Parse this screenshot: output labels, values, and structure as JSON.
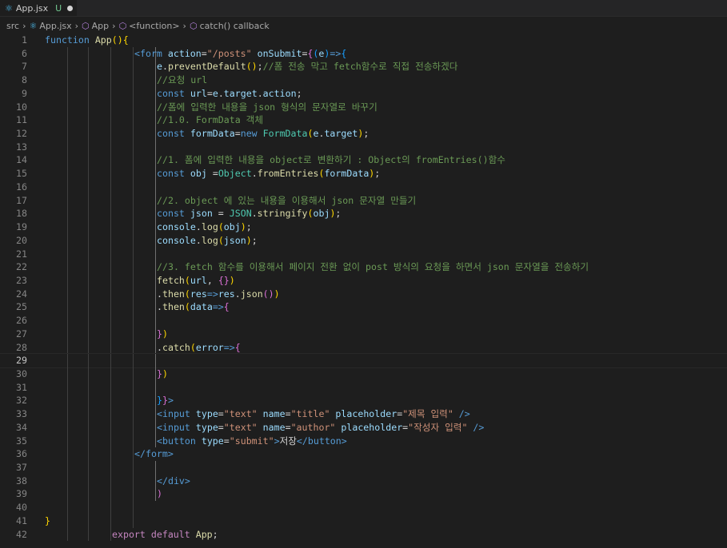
{
  "tab": {
    "filename": "App.jsx",
    "status": "U"
  },
  "breadcrumb": {
    "items": [
      "src",
      "App.jsx",
      "App",
      "<function>",
      "catch() callback"
    ]
  },
  "editor": {
    "active_line": "29",
    "lines": [
      {
        "n": "1",
        "tokens": [
          [
            "k",
            "function"
          ],
          [
            "w",
            " "
          ],
          [
            "f",
            "App"
          ],
          [
            "b1",
            "()"
          ],
          [
            "b1",
            "{"
          ]
        ]
      },
      {
        "n": "6",
        "tokens": [
          [
            "tag",
            "<form "
          ],
          [
            "v",
            "action"
          ],
          [
            "w",
            "="
          ],
          [
            "s",
            "\"/posts\""
          ],
          [
            "w",
            " "
          ],
          [
            "v",
            "onSubmit"
          ],
          [
            "w",
            "="
          ],
          [
            "b2",
            "{"
          ],
          [
            "b3",
            "("
          ],
          [
            "v",
            "e"
          ],
          [
            "b3",
            ")"
          ],
          [
            "k",
            "=>"
          ],
          [
            "b3",
            "{"
          ]
        ]
      },
      {
        "n": "7",
        "tokens": [
          [
            "v",
            "e"
          ],
          [
            "w",
            "."
          ],
          [
            "f",
            "preventDefault"
          ],
          [
            "b1",
            "()"
          ],
          [
            "w",
            ";"
          ],
          [
            "cm",
            "//폼 전송 막고 fetch함수로 직접 전송하겠다"
          ]
        ]
      },
      {
        "n": "8",
        "tokens": [
          [
            "cm",
            "//요청 url"
          ]
        ]
      },
      {
        "n": "9",
        "tokens": [
          [
            "k",
            "const "
          ],
          [
            "v",
            "url"
          ],
          [
            "w",
            "="
          ],
          [
            "v",
            "e"
          ],
          [
            "w",
            "."
          ],
          [
            "v",
            "target"
          ],
          [
            "w",
            "."
          ],
          [
            "v",
            "action"
          ],
          [
            "w",
            ";"
          ]
        ]
      },
      {
        "n": "10",
        "tokens": [
          [
            "cm",
            "//폼에 입력한 내용을 json 형식의 문자열로 바꾸기"
          ]
        ]
      },
      {
        "n": "11",
        "tokens": [
          [
            "cm",
            "//1.0. FormData 객체"
          ]
        ]
      },
      {
        "n": "12",
        "tokens": [
          [
            "k",
            "const "
          ],
          [
            "v",
            "formData"
          ],
          [
            "w",
            "="
          ],
          [
            "k",
            "new "
          ],
          [
            "t",
            "FormData"
          ],
          [
            "b1",
            "("
          ],
          [
            "v",
            "e"
          ],
          [
            "w",
            "."
          ],
          [
            "v",
            "target"
          ],
          [
            "b1",
            ")"
          ],
          [
            "w",
            ";"
          ]
        ]
      },
      {
        "n": "13",
        "tokens": []
      },
      {
        "n": "14",
        "tokens": [
          [
            "cm",
            "//1. 폼에 입력한 내용을 object로 변환하기 : Object의 fromEntries()함수"
          ]
        ]
      },
      {
        "n": "15",
        "tokens": [
          [
            "k",
            "const "
          ],
          [
            "v",
            "obj"
          ],
          [
            "w",
            " ="
          ],
          [
            "t",
            "Object"
          ],
          [
            "w",
            "."
          ],
          [
            "f",
            "fromEntries"
          ],
          [
            "b1",
            "("
          ],
          [
            "v",
            "formData"
          ],
          [
            "b1",
            ")"
          ],
          [
            "w",
            ";"
          ]
        ]
      },
      {
        "n": "16",
        "tokens": []
      },
      {
        "n": "17",
        "tokens": [
          [
            "cm",
            "//2. object 에 있는 내용을 이용해서 json 문자열 만들기"
          ]
        ]
      },
      {
        "n": "18",
        "tokens": [
          [
            "k",
            "const "
          ],
          [
            "v",
            "json"
          ],
          [
            "w",
            " = "
          ],
          [
            "t",
            "JSON"
          ],
          [
            "w",
            "."
          ],
          [
            "f",
            "stringify"
          ],
          [
            "b1",
            "("
          ],
          [
            "v",
            "obj"
          ],
          [
            "b1",
            ")"
          ],
          [
            "w",
            ";"
          ]
        ]
      },
      {
        "n": "19",
        "tokens": [
          [
            "v",
            "console"
          ],
          [
            "w",
            "."
          ],
          [
            "f",
            "log"
          ],
          [
            "b1",
            "("
          ],
          [
            "v",
            "obj"
          ],
          [
            "b1",
            ")"
          ],
          [
            "w",
            ";"
          ]
        ]
      },
      {
        "n": "20",
        "tokens": [
          [
            "v",
            "console"
          ],
          [
            "w",
            "."
          ],
          [
            "f",
            "log"
          ],
          [
            "b1",
            "("
          ],
          [
            "v",
            "json"
          ],
          [
            "b1",
            ")"
          ],
          [
            "w",
            ";"
          ]
        ]
      },
      {
        "n": "21",
        "tokens": []
      },
      {
        "n": "22",
        "tokens": [
          [
            "cm",
            "//3. fetch 함수를 이용해서 페이지 전환 없이 post 방식의 요청을 하면서 json 문자열을 전송하기"
          ]
        ]
      },
      {
        "n": "23",
        "tokens": [
          [
            "f",
            "fetch"
          ],
          [
            "b1",
            "("
          ],
          [
            "v",
            "url"
          ],
          [
            "w",
            ", "
          ],
          [
            "b2",
            "{}"
          ],
          [
            "b1",
            ")"
          ]
        ]
      },
      {
        "n": "24",
        "tokens": [
          [
            "w",
            "."
          ],
          [
            "f",
            "then"
          ],
          [
            "b1",
            "("
          ],
          [
            "v",
            "res"
          ],
          [
            "k",
            "=>"
          ],
          [
            "v",
            "res"
          ],
          [
            "w",
            "."
          ],
          [
            "f",
            "json"
          ],
          [
            "b2",
            "()"
          ],
          [
            "b1",
            ")"
          ]
        ]
      },
      {
        "n": "25",
        "tokens": [
          [
            "w",
            "."
          ],
          [
            "f",
            "then"
          ],
          [
            "b1",
            "("
          ],
          [
            "v",
            "data"
          ],
          [
            "k",
            "=>"
          ],
          [
            "b2",
            "{"
          ]
        ]
      },
      {
        "n": "26",
        "tokens": []
      },
      {
        "n": "27",
        "tokens": [
          [
            "b2",
            "}"
          ],
          [
            "b1",
            ")"
          ]
        ]
      },
      {
        "n": "28",
        "tokens": [
          [
            "w",
            "."
          ],
          [
            "f",
            "catch"
          ],
          [
            "b1",
            "("
          ],
          [
            "v",
            "error"
          ],
          [
            "k",
            "=>"
          ],
          [
            "b2",
            "{"
          ]
        ]
      },
      {
        "n": "29",
        "tokens": []
      },
      {
        "n": "30",
        "tokens": [
          [
            "b2",
            "}"
          ],
          [
            "b1",
            ")"
          ]
        ]
      },
      {
        "n": "31",
        "tokens": []
      },
      {
        "n": "32",
        "tokens": [
          [
            "b3",
            "}"
          ],
          [
            "b2",
            "}"
          ],
          [
            "tag",
            ">"
          ]
        ]
      },
      {
        "n": "33",
        "tokens": [
          [
            "tag",
            "<input "
          ],
          [
            "v",
            "type"
          ],
          [
            "w",
            "="
          ],
          [
            "s",
            "\"text\""
          ],
          [
            "w",
            " "
          ],
          [
            "v",
            "name"
          ],
          [
            "w",
            "="
          ],
          [
            "s",
            "\"title\""
          ],
          [
            "w",
            " "
          ],
          [
            "v",
            "placeholder"
          ],
          [
            "w",
            "="
          ],
          [
            "s",
            "\"제목 입력\""
          ],
          [
            "tag",
            " />"
          ]
        ]
      },
      {
        "n": "34",
        "tokens": [
          [
            "tag",
            "<input "
          ],
          [
            "v",
            "type"
          ],
          [
            "w",
            "="
          ],
          [
            "s",
            "\"text\""
          ],
          [
            "w",
            " "
          ],
          [
            "v",
            "name"
          ],
          [
            "w",
            "="
          ],
          [
            "s",
            "\"author\""
          ],
          [
            "w",
            " "
          ],
          [
            "v",
            "placeholder"
          ],
          [
            "w",
            "="
          ],
          [
            "s",
            "\"작성자 입력\""
          ],
          [
            "tag",
            " />"
          ]
        ]
      },
      {
        "n": "35",
        "tokens": [
          [
            "tag",
            "<button "
          ],
          [
            "v",
            "type"
          ],
          [
            "w",
            "="
          ],
          [
            "s",
            "\"submit\""
          ],
          [
            "tag",
            ">"
          ],
          [
            "w",
            "저장"
          ],
          [
            "tag",
            "</button>"
          ]
        ]
      },
      {
        "n": "36",
        "tokens": [
          [
            "tag",
            "</form>"
          ]
        ]
      },
      {
        "n": "37",
        "tokens": []
      },
      {
        "n": "38",
        "tokens": [
          [
            "tag",
            "</div>"
          ]
        ]
      },
      {
        "n": "39",
        "tokens": [
          [
            "b2",
            ")"
          ]
        ]
      },
      {
        "n": "40",
        "tokens": []
      },
      {
        "n": "41",
        "tokens": [
          [
            "b1",
            "}"
          ]
        ]
      },
      {
        "n": "42",
        "tokens": [
          [
            "c",
            "export "
          ],
          [
            "c",
            "default "
          ],
          [
            "f",
            "App"
          ],
          [
            "w",
            ";"
          ]
        ]
      }
    ]
  }
}
